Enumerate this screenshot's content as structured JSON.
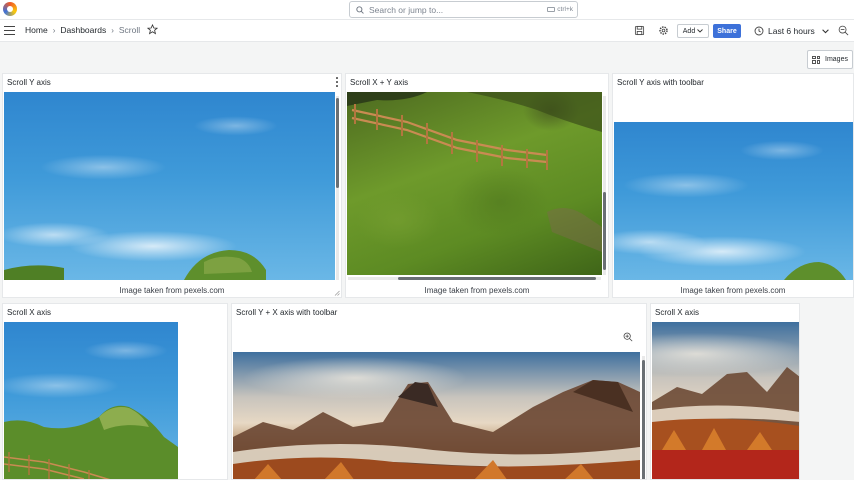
{
  "topbar": {
    "search_placeholder": "Search or jump to...",
    "search_shortcut": "ctrl+k"
  },
  "navbar": {
    "breadcrumbs": [
      "Home",
      "Dashboards",
      "Scroll"
    ],
    "add_label": "Add",
    "share_label": "Share",
    "time_range": "Last 6 hours",
    "images_toggle_label": "Images"
  },
  "panels": [
    {
      "title": "Scroll Y axis",
      "caption": "Image taken from pexels.com"
    },
    {
      "title": "Scroll X + Y axis",
      "caption": "Image taken from pexels.com"
    },
    {
      "title": "Scroll Y axis with toolbar",
      "caption": "Image taken from pexels.com"
    },
    {
      "title": "Scroll X axis"
    },
    {
      "title": "Scroll Y + X axis with toolbar"
    },
    {
      "title": "Scroll X axis"
    }
  ],
  "colors": {
    "accent": "#3d71d9",
    "background": "#f4f5f5",
    "panel": "#ffffff"
  }
}
